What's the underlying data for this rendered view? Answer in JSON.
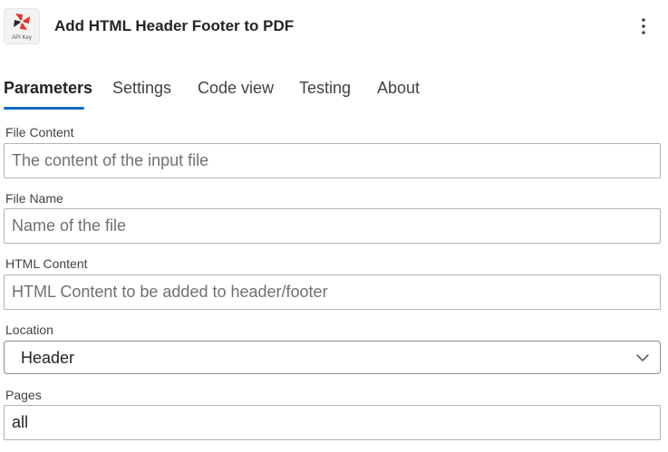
{
  "header": {
    "title": "Add HTML Header Footer to PDF",
    "app_icon": "red-pinwheel-logo",
    "app_icon_caption": "API Key",
    "more_icon": "more-vertical-icon"
  },
  "tabs": [
    {
      "label": "Parameters",
      "active": true
    },
    {
      "label": "Settings",
      "active": false
    },
    {
      "label": "Code view",
      "active": false
    },
    {
      "label": "Testing",
      "active": false
    },
    {
      "label": "About",
      "active": false
    }
  ],
  "fields": {
    "file_content": {
      "label": "File Content",
      "value": "",
      "placeholder": "The content of the input file"
    },
    "file_name": {
      "label": "File Name",
      "value": "",
      "placeholder": "Name of the file"
    },
    "html_content": {
      "label": "HTML Content",
      "value": "",
      "placeholder": "HTML Content to be added to header/footer"
    },
    "location": {
      "label": "Location",
      "selected": "Header"
    },
    "pages": {
      "label": "Pages",
      "value": "all",
      "placeholder": ""
    }
  },
  "colors": {
    "accent": "#0f6cbd",
    "logo_red": "#e8312a",
    "logo_dark": "#2b2b2b"
  }
}
